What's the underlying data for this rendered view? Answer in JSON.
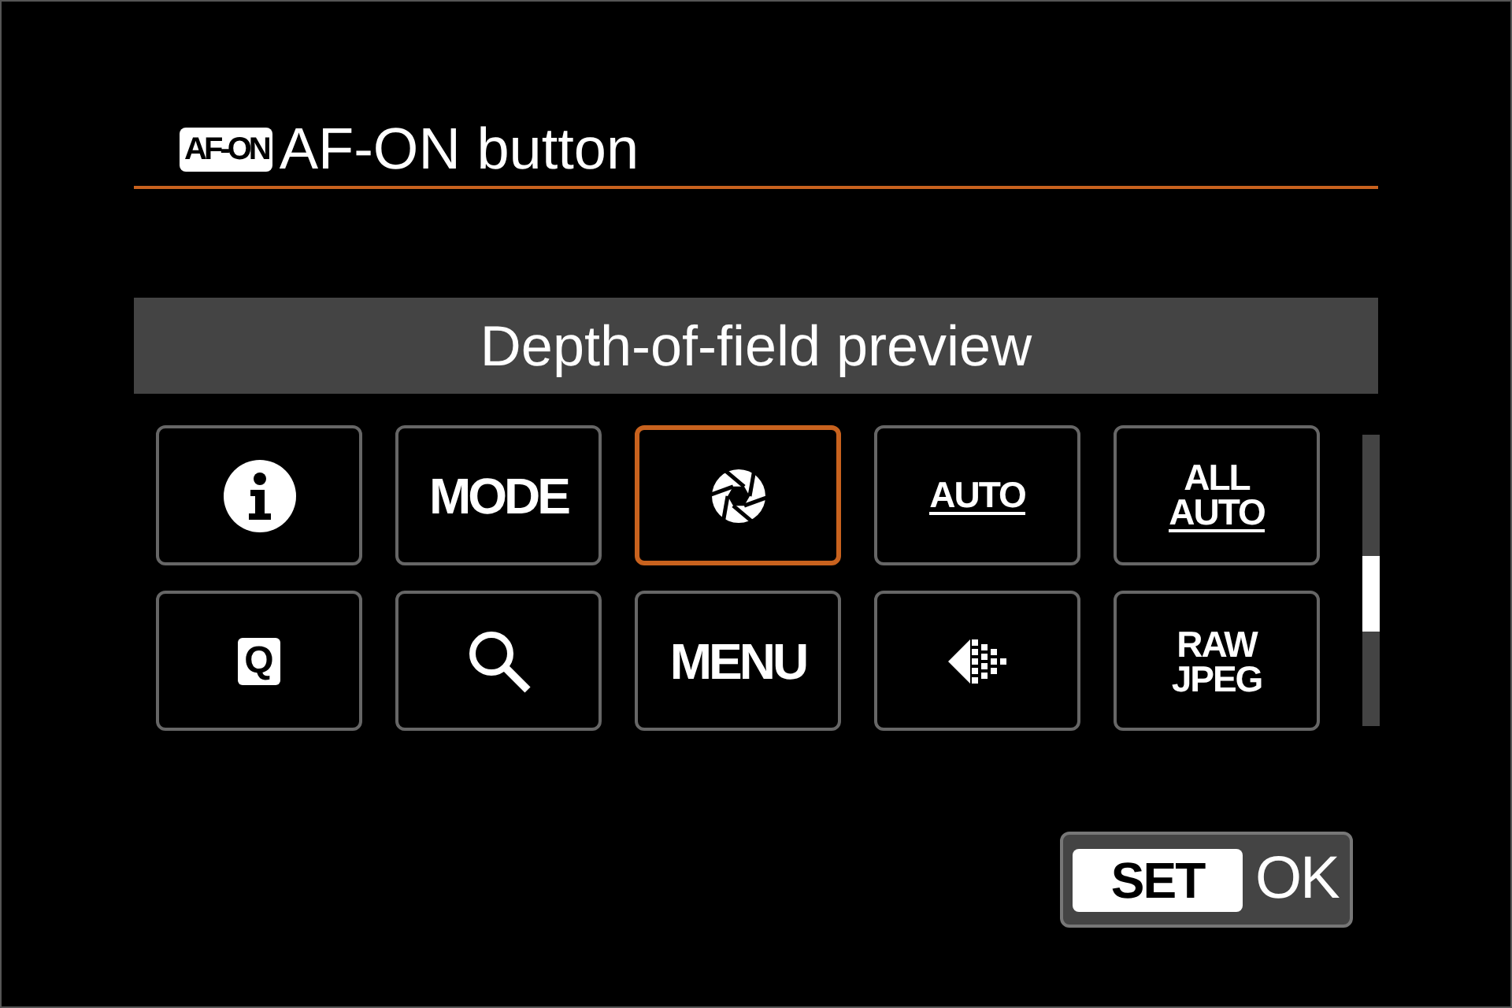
{
  "header": {
    "badge": "AF-ON",
    "title": "AF-ON button"
  },
  "banner": "Depth-of-field preview",
  "options": [
    {
      "kind": "info",
      "selected": false
    },
    {
      "kind": "text",
      "lines": [
        "MODE"
      ],
      "selected": false
    },
    {
      "kind": "aperture",
      "selected": true
    },
    {
      "kind": "small-text",
      "lines": [
        "AUTO"
      ],
      "underline": true,
      "selected": false
    },
    {
      "kind": "small-text",
      "lines": [
        "ALL",
        "AUTO"
      ],
      "underline": true,
      "selected": false
    },
    {
      "kind": "boxed",
      "lines": [
        "Q"
      ],
      "selected": false
    },
    {
      "kind": "search",
      "selected": false
    },
    {
      "kind": "text",
      "lines": [
        "MENU"
      ],
      "selected": false
    },
    {
      "kind": "dots",
      "selected": false
    },
    {
      "kind": "small-text",
      "lines": [
        "RAW",
        "JPEG"
      ],
      "underline": false,
      "selected": false
    }
  ],
  "set_button": {
    "key": "SET",
    "label": "OK"
  }
}
